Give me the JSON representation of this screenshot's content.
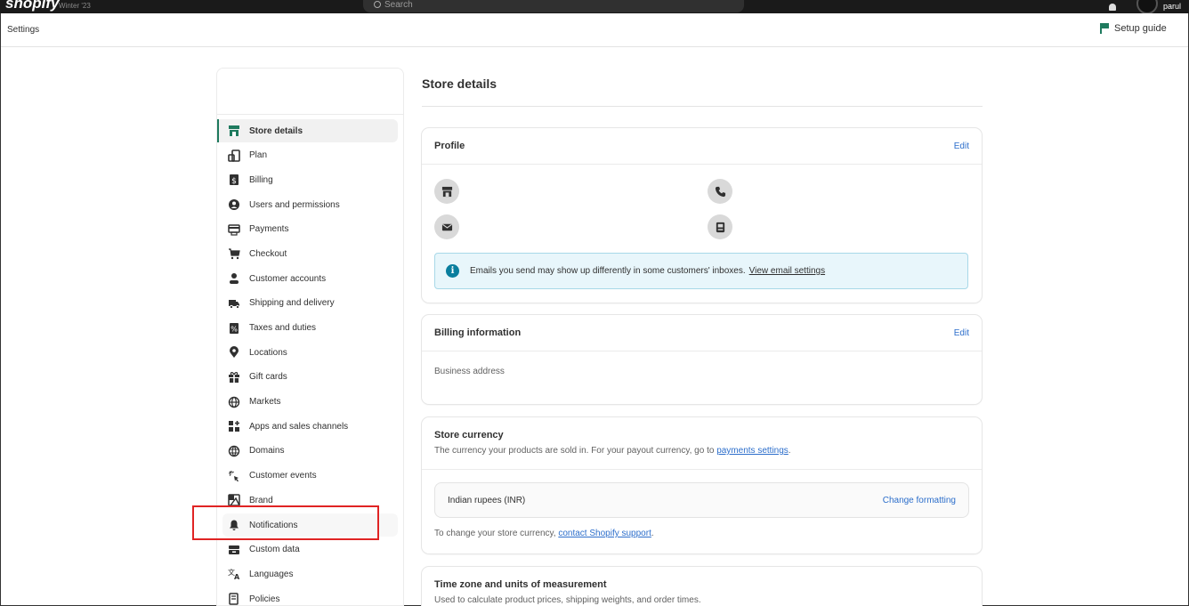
{
  "topbar": {
    "logo": "shopify",
    "store_name": "Winter '23",
    "search_placeholder": "Search",
    "user_name": "parul"
  },
  "header": {
    "title": "Settings",
    "setup_guide": "Setup guide"
  },
  "sidebar": {
    "items": [
      {
        "label": "Store details",
        "icon": "store-icon"
      },
      {
        "label": "Plan",
        "icon": "plan-icon"
      },
      {
        "label": "Billing",
        "icon": "billing-icon"
      },
      {
        "label": "Users and permissions",
        "icon": "user-circle-icon"
      },
      {
        "label": "Payments",
        "icon": "payments-icon"
      },
      {
        "label": "Checkout",
        "icon": "cart-icon"
      },
      {
        "label": "Customer accounts",
        "icon": "person-icon"
      },
      {
        "label": "Shipping and delivery",
        "icon": "truck-icon"
      },
      {
        "label": "Taxes and duties",
        "icon": "tax-icon"
      },
      {
        "label": "Locations",
        "icon": "location-pin-icon"
      },
      {
        "label": "Gift cards",
        "icon": "gift-icon"
      },
      {
        "label": "Markets",
        "icon": "globe-icon"
      },
      {
        "label": "Apps and sales channels",
        "icon": "apps-icon"
      },
      {
        "label": "Domains",
        "icon": "domains-globe-icon"
      },
      {
        "label": "Customer events",
        "icon": "cursor-sparkle-icon"
      },
      {
        "label": "Brand",
        "icon": "brand-icon"
      },
      {
        "label": "Notifications",
        "icon": "bell-icon"
      },
      {
        "label": "Custom data",
        "icon": "custom-data-icon"
      },
      {
        "label": "Languages",
        "icon": "translate-icon"
      },
      {
        "label": "Policies",
        "icon": "policies-icon"
      }
    ]
  },
  "main": {
    "page_title": "Store details",
    "profile": {
      "title": "Profile",
      "edit": "Edit",
      "banner_text": "Emails you send may show up differently in some customers' inboxes.",
      "banner_link": "View email settings"
    },
    "billing": {
      "title": "Billing information",
      "edit": "Edit",
      "business_address": "Business address"
    },
    "currency": {
      "title": "Store currency",
      "desc_prefix": "The currency your products are sold in. For your payout currency, go to",
      "desc_link": "payments settings",
      "desc_suffix": ".",
      "currency_name": "Indian rupees (INR)",
      "change_formatting": "Change formatting",
      "footer_prefix": "To change your store currency,",
      "footer_link": "contact Shopify support",
      "footer_suffix": "."
    },
    "timezone": {
      "title": "Time zone and units of measurement",
      "desc": "Used to calculate product prices, shipping weights, and order times."
    }
  },
  "colors": {
    "accent": "#1e7a5e",
    "link": "#2c6ecb",
    "highlight_box": "#e02424",
    "info_banner": "#e8f6fb"
  }
}
